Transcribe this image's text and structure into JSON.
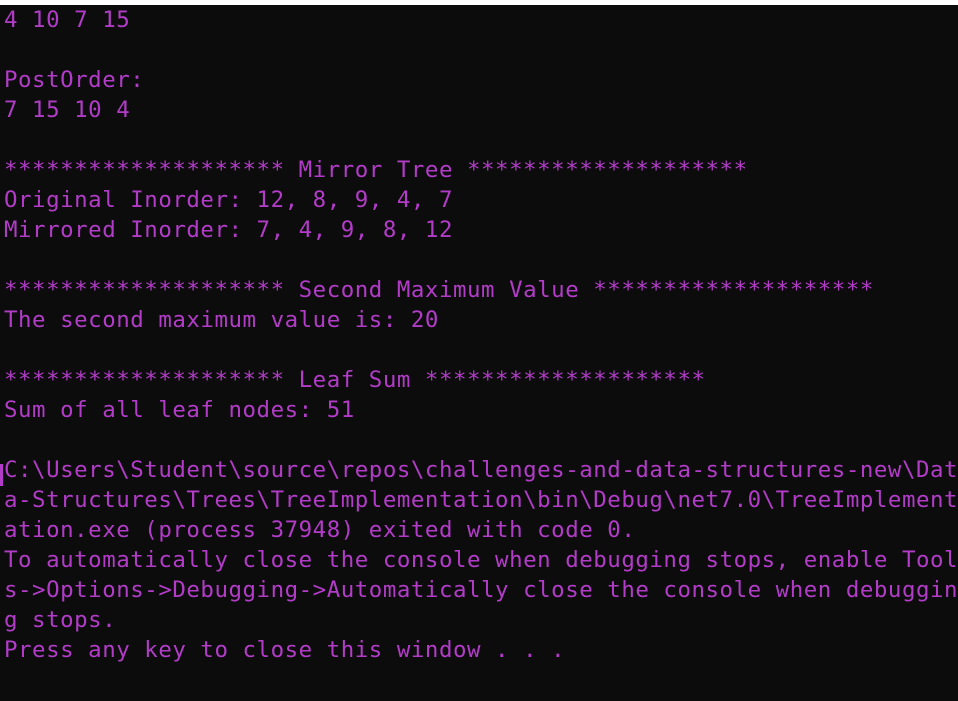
{
  "colors": {
    "background": "#0c0c0c",
    "text": "#b23cc8"
  },
  "console": {
    "lines": [
      "4 10 7 15",
      "",
      "PostOrder:",
      "7 15 10 4",
      "",
      "******************** Mirror Tree ********************",
      "Original Inorder: 12, 8, 9, 4, 7",
      "Mirrored Inorder: 7, 4, 9, 8, 12",
      "",
      "******************** Second Maximum Value ********************",
      "The second maximum value is: 20",
      "",
      "******************** Leaf Sum ********************",
      "Sum of all leaf nodes: 51",
      "",
      "C:\\Users\\Student\\source\\repos\\challenges-and-data-structures-new\\Dat",
      "a-Structures\\Trees\\TreeImplementation\\bin\\Debug\\net7.0\\TreeImplement",
      "ation.exe (process 37948) exited with code 0.",
      "To automatically close the console when debugging stops, enable Tool",
      "s->Options->Debugging->Automatically close the console when debuggin",
      "g stops.",
      "Press any key to close this window . . ."
    ]
  }
}
